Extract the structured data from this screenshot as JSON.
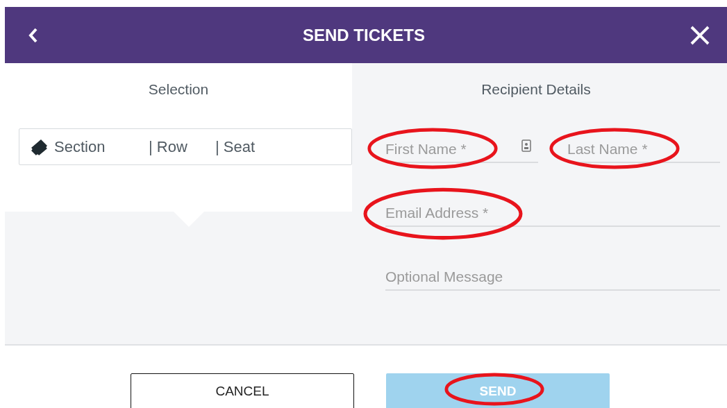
{
  "header": {
    "title": "SEND TICKETS"
  },
  "selection": {
    "title": "Selection",
    "section": "Section",
    "row": "| Row",
    "seat": "| Seat"
  },
  "recipient": {
    "title": "Recipient Details",
    "fields": [
      {
        "placeholder": "First Name *",
        "circled": true,
        "contact_icon": true
      },
      {
        "placeholder": "Last Name *",
        "circled": true,
        "contact_icon": false
      },
      {
        "placeholder": "Email Address *",
        "circled": true,
        "contact_icon": false
      },
      {
        "placeholder": "Optional Message",
        "circled": false,
        "contact_icon": false
      }
    ]
  },
  "buttons": [
    {
      "label": "CANCEL",
      "kind": "outline",
      "circled": false
    },
    {
      "label": "SEND",
      "kind": "disabled",
      "circled": true
    }
  ]
}
